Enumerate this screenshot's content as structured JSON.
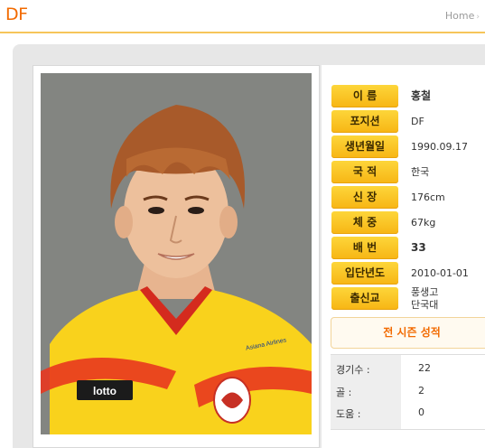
{
  "header": {
    "title": "DF",
    "breadcrumb": "Home"
  },
  "profile": {
    "fields": [
      {
        "label": "이 름",
        "value": "홍철",
        "bold": true
      },
      {
        "label": "포지션",
        "value": "DF"
      },
      {
        "label": "생년월일",
        "value": "1990.09.17"
      },
      {
        "label": "국 적",
        "value": "한국"
      },
      {
        "label": "신 장",
        "value": "176cm"
      },
      {
        "label": "체 중",
        "value": "67kg"
      },
      {
        "label": "배 번",
        "value": "33",
        "bold": true
      },
      {
        "label": "입단년도",
        "value": "2010-01-01"
      },
      {
        "label": "출신교",
        "value_line1": "풍생고",
        "value_line2": "단국대"
      }
    ]
  },
  "season": {
    "button_label": "전 시즌 성적",
    "stats": [
      {
        "label": "경기수 :",
        "value": "22"
      },
      {
        "label": "골 :",
        "value": "2"
      },
      {
        "label": "도움 :",
        "value": "0"
      }
    ]
  },
  "photo": {
    "jersey_brand": "lotto",
    "jersey_sponsor": "Asiana Airlines"
  },
  "colors": {
    "accent": "#f26a00",
    "pill": "#f9c21e",
    "rule": "#f6c55a"
  }
}
